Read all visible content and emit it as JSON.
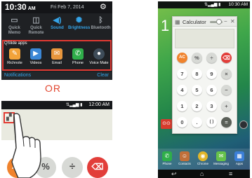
{
  "panel1": {
    "status": {
      "time": "10:30",
      "ampm": "AM",
      "date": "Fri Feb 7, 2014",
      "settings_icon": "gear-icon"
    },
    "quick_settings": [
      {
        "label_line1": "Quick",
        "label_line2": "Memo",
        "icon": "memo-icon",
        "state": "off"
      },
      {
        "label_line1": "Quick",
        "label_line2": "Remote",
        "icon": "remote-icon",
        "state": "off"
      },
      {
        "label_line1": "Sound",
        "label_line2": "",
        "icon": "sound-icon",
        "state": "on"
      },
      {
        "label_line1": "Brightness",
        "label_line2": "",
        "icon": "brightness-icon",
        "state": "on"
      },
      {
        "label_line1": "Bluetooth",
        "label_line2": "",
        "icon": "bluetooth-icon",
        "state": "off"
      }
    ],
    "qslide_label": "QSlide apps",
    "qslide_apps": [
      {
        "label": "Richnote",
        "icon": "richnote-icon",
        "color": "#f3a33a"
      },
      {
        "label": "Videos",
        "icon": "videos-icon",
        "color": "#3b87d6"
      },
      {
        "label": "Email",
        "icon": "email-icon",
        "color": "#e7963d"
      },
      {
        "label": "Phone",
        "icon": "phone-icon",
        "color": "#2fae4a"
      },
      {
        "label": "Voice Mate",
        "icon": "voice-mate-icon",
        "color": "#3e4c59"
      }
    ],
    "notifications_label": "Notifications",
    "clear_label": "Clear",
    "highlight_color": "#e23a33"
  },
  "or_label": "OR",
  "panel2": {
    "status": {
      "time": "12:00 AM"
    },
    "buttons": [
      {
        "label": "AC",
        "color": "#f0832d"
      },
      {
        "label": "%",
        "color": "#d7d9d5"
      },
      {
        "label": "÷",
        "color": "#d7d9d5"
      },
      {
        "label": "⌫",
        "color": "#e23e3a"
      }
    ]
  },
  "panel3": {
    "status": {
      "time": "10:30 AM"
    },
    "bigtime": "1",
    "calculator_title": "Calculator",
    "keys": [
      [
        "AC",
        "%",
        "÷",
        "⌫"
      ],
      [
        "7",
        "8",
        "9",
        "×"
      ],
      [
        "4",
        "5",
        "6",
        "−"
      ],
      [
        "1",
        "2",
        "3",
        "+"
      ],
      [
        "0",
        ".",
        "( )",
        "="
      ]
    ],
    "dock": [
      {
        "label": "Phone",
        "color": "#2fae4a"
      },
      {
        "label": "Contacts",
        "color": "#c0703a"
      },
      {
        "label": "Chrome",
        "color": "#e0b62a"
      },
      {
        "label": "Messaging",
        "color": "#66c24a"
      },
      {
        "label": "Apps",
        "color": "#3b7fd8"
      }
    ]
  }
}
